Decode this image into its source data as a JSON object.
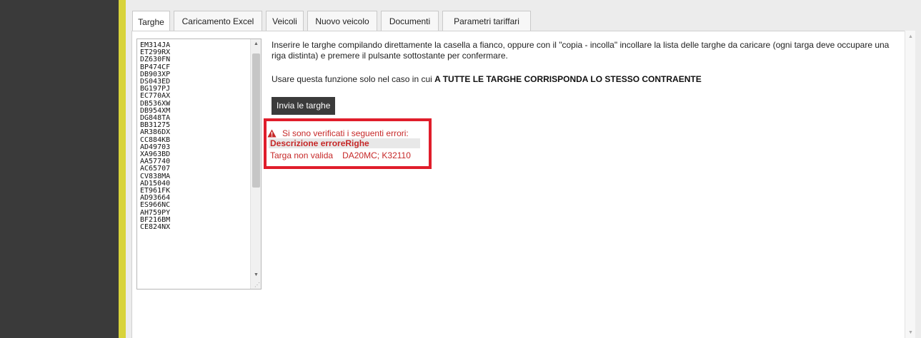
{
  "tabs": [
    {
      "label": "Targhe",
      "active": true
    },
    {
      "label": "Caricamento Excel",
      "active": false
    },
    {
      "label": "Veicoli",
      "active": false
    },
    {
      "label": "Nuovo veicolo",
      "active": false
    },
    {
      "label": "Documenti",
      "active": false
    },
    {
      "label": "Parametri tariffari",
      "active": false
    }
  ],
  "plates_textarea": {
    "value": "EM314JA\nET299RX\nDZ630FN\nBP474CF\nDB903XP\nDS043ED\nBG197PJ\nEC770AX\nDB536XW\nDB954XM\nDG848TA\nBB31275\nAR386DX\nCC884KB\nAD49703\nXA963BD\nAA57740\nAC65707\nCV838MA\nAD15040\nET961FK\nAD93664\nES966NC\nAH759PY\nBF216BM\nCE824NX"
  },
  "instructions": {
    "line1": "Inserire le targhe compilando direttamente la casella a fianco, oppure con il \"copia - incolla\" incollare la lista delle targhe da caricare  (ogni targa deve occupare una riga distinta) e premere il pulsante sottostante per confermare.",
    "line2_prefix": "Usare questa funzione solo nel caso in cui ",
    "line2_bold": "A TUTTE LE TARGHE CORRISPONDA LO STESSO CONTRAENTE"
  },
  "submit_button": {
    "label": "Invia le targhe"
  },
  "errors": {
    "header": "Si sono verificati i seguenti errori:",
    "subheader": "Descrizione erroreRighe",
    "row_description": "Targa non valida",
    "row_lines": "DA20MC; K32110"
  },
  "colors": {
    "sidebar": "#3a3a3a",
    "accent": "#d8d33b",
    "error": "#c62828",
    "error_border": "#e01d2b",
    "button": "#3b3b3b"
  }
}
